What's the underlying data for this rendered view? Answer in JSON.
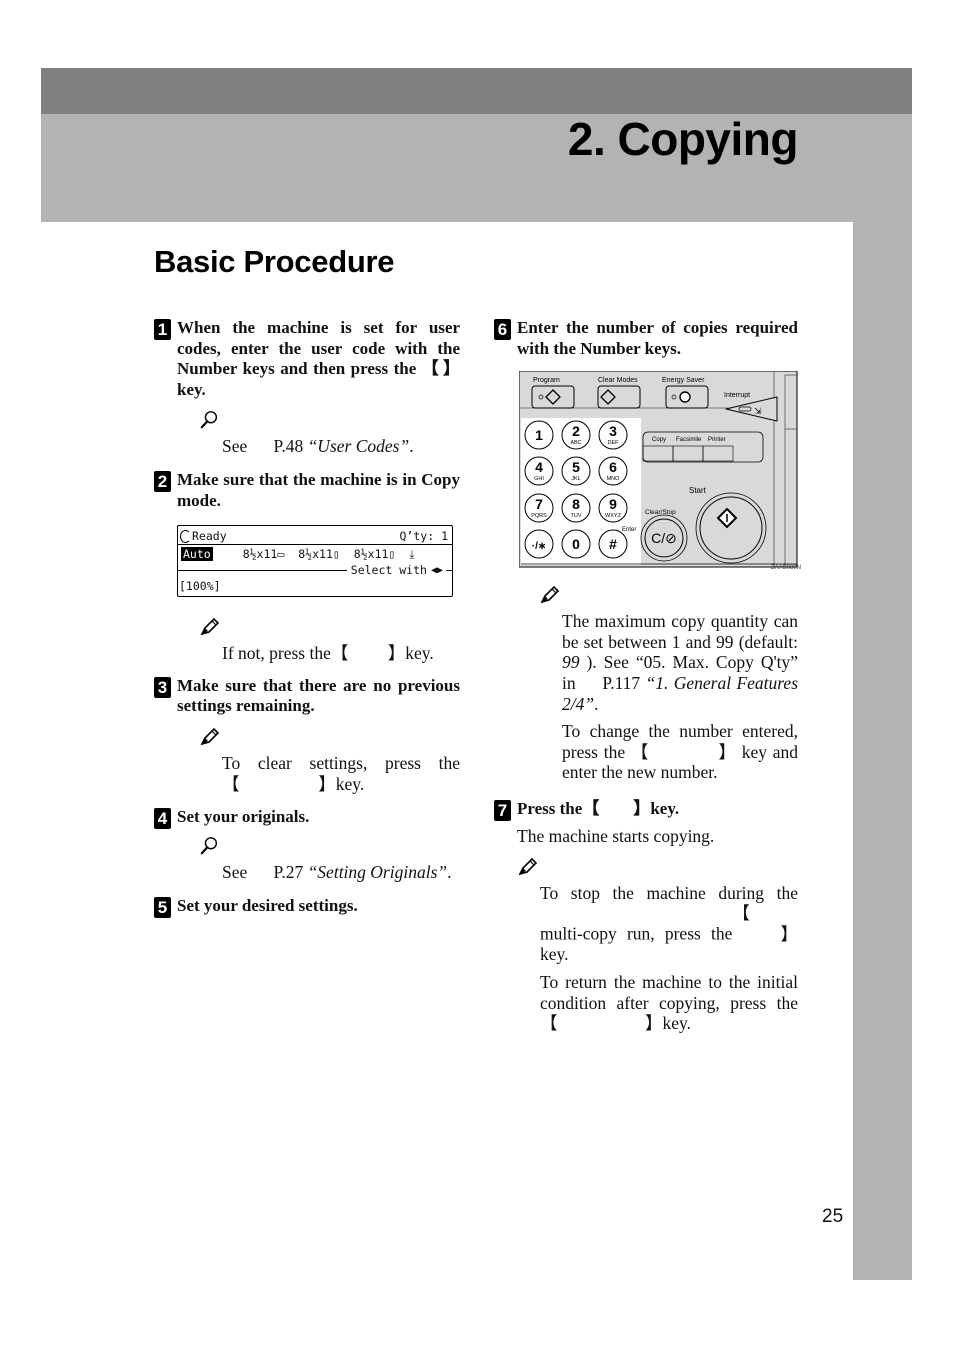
{
  "header": {
    "chapter_title": "2. Copying"
  },
  "section": {
    "title": "Basic Procedure"
  },
  "page_number": "25",
  "steps": [
    {
      "number": "1",
      "heading_pre": "When the machine is set for user codes, enter the user code with the Number keys and then press the",
      "heading_post": "key.",
      "note": {
        "icon": "reference-magnifier-icon",
        "see": "See",
        "page": "P.48",
        "ref": "“User Codes”",
        "end": "."
      }
    },
    {
      "number": "2",
      "heading": "Make sure that the machine is in Copy mode.",
      "lcd": {
        "status": "Ready",
        "qty_label": "Q’ty:",
        "qty_value": "1",
        "paper_auto": "Auto",
        "paper_options": [
          "8½x11▭",
          "8½x11▯",
          "8½x11▯",
          "⤓"
        ],
        "select_with": "Select with",
        "ratio": "[100%]"
      },
      "note": {
        "icon": "note-pencil-icon",
        "text_pre": "If not, press the",
        "text_post": "key."
      }
    },
    {
      "number": "3",
      "heading": "Make sure that there are no previous settings remaining.",
      "note": {
        "icon": "note-pencil-icon",
        "text_pre": "To clear settings, press the",
        "text_post": "key."
      }
    },
    {
      "number": "4",
      "heading": "Set your originals.",
      "note": {
        "icon": "reference-magnifier-icon",
        "see": "See",
        "page": "P.27",
        "ref": "“Setting Originals”",
        "end": "."
      }
    },
    {
      "number": "5",
      "heading": "Set your desired settings."
    },
    {
      "number": "6",
      "heading": "Enter the number of copies required with the Number keys.",
      "panel": {
        "labels": {
          "program": "Program",
          "clear_modes": "Clear Modes",
          "energy_saver": "Energy Saver",
          "interrupt": "Interrupt",
          "copy": "Copy",
          "facsimile": "Facsimile",
          "printer": "Printer",
          "start": "Start",
          "clear_stop": "Clear/Stop",
          "enter": "Enter",
          "clear_stop_key": "C/⊘",
          "figure_code": "ZAAS080N"
        },
        "keypad": [
          {
            "main": "1",
            "sub": ""
          },
          {
            "main": "2",
            "sub": "ABC"
          },
          {
            "main": "3",
            "sub": "DEF"
          },
          {
            "main": "4",
            "sub": "GHI"
          },
          {
            "main": "5",
            "sub": "JKL"
          },
          {
            "main": "6",
            "sub": "MNO"
          },
          {
            "main": "7",
            "sub": "PQRS"
          },
          {
            "main": "8",
            "sub": "TUV"
          },
          {
            "main": "9",
            "sub": "WXYZ"
          },
          {
            "main": "·/∗",
            "sub": ""
          },
          {
            "main": "0",
            "sub": ""
          },
          {
            "main": "#",
            "sub": ""
          }
        ]
      },
      "notes": {
        "icon": "note-pencil-icon",
        "para1": {
          "t1": "The maximum copy quantity can be set between 1 and 99 (default:",
          "default_value": "99",
          "t2": "). See “05. Max. Copy Q'ty” in",
          "page": "P.117",
          "ref": "“1. General Features 2/4”",
          "end": "."
        },
        "para2": {
          "pre": "To change the number entered, press the",
          "post": "key and enter the new number."
        }
      }
    },
    {
      "number": "7",
      "heading_pre": "Press the",
      "heading_post": "key.",
      "body": "The machine starts copying.",
      "notes": {
        "icon": "note-pencil-icon",
        "para1_pre": "To stop the machine during the multi-copy run, press the",
        "para1_post": "key.",
        "para2_pre": "To return the machine to the initial condition after copying, press the",
        "para2_post": "key."
      }
    }
  ]
}
